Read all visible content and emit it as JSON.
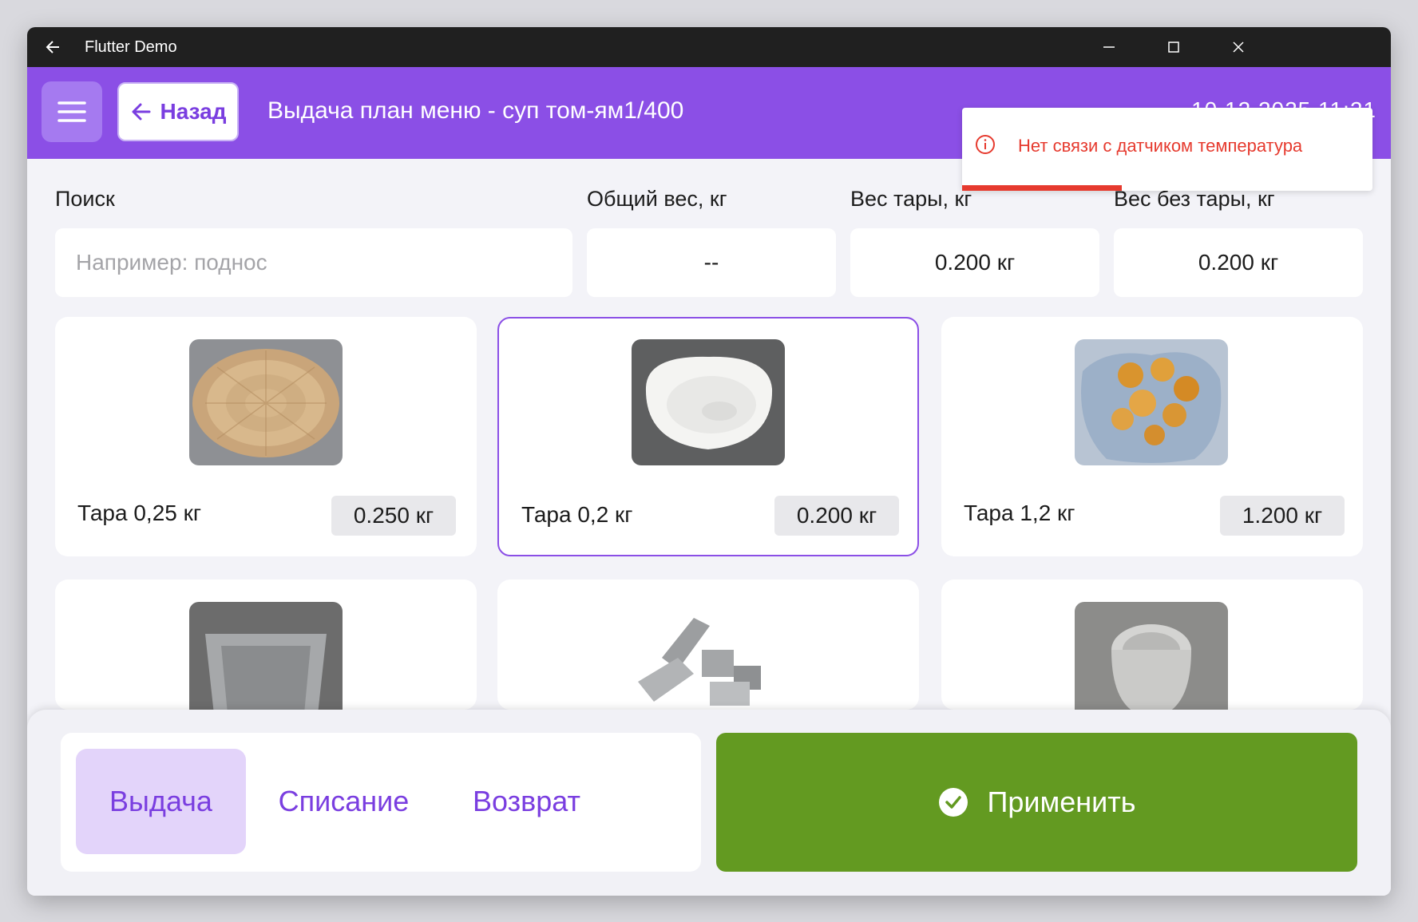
{
  "window": {
    "title": "Flutter Demo"
  },
  "appbar": {
    "back_label": "Назад",
    "title": "Выдача план меню - суп том-ям1/400",
    "datetime": "10.12.2025 11:21"
  },
  "toast": {
    "message": "Нет связи с датчиком температура",
    "color": "#e63a2e"
  },
  "fields": {
    "search_label": "Поиск",
    "search_placeholder": "Например: поднос",
    "total_label": "Общий вес, кг",
    "total_value": "--",
    "tare_label": "Вес тары, кг",
    "tare_value": "0.200 кг",
    "net_label": "Вес без тары, кг",
    "net_value": "0.200 кг"
  },
  "items": [
    {
      "name": "Тара 0,25 кг",
      "weight": "0.250 кг",
      "selected": false,
      "icon": "wicker-basket-image"
    },
    {
      "name": "Тара 0,2 кг",
      "weight": "0.200 кг",
      "selected": true,
      "icon": "white-bowl-image"
    },
    {
      "name": "Тара 1,2 кг",
      "weight": "1.200 кг",
      "selected": false,
      "icon": "glass-dish-cookies-image"
    },
    {
      "icon": "steel-pan-image"
    },
    {
      "icon": "gastronorm-containers-image"
    },
    {
      "icon": "steel-bowl-image"
    }
  ],
  "bottom": {
    "tabs": [
      "Выдача",
      "Списание",
      "Возврат"
    ],
    "active_tab": "Выдача",
    "apply_label": "Применить"
  },
  "colors": {
    "accent": "#8b4fe6",
    "apply": "#639a21",
    "error": "#e63a2e"
  }
}
